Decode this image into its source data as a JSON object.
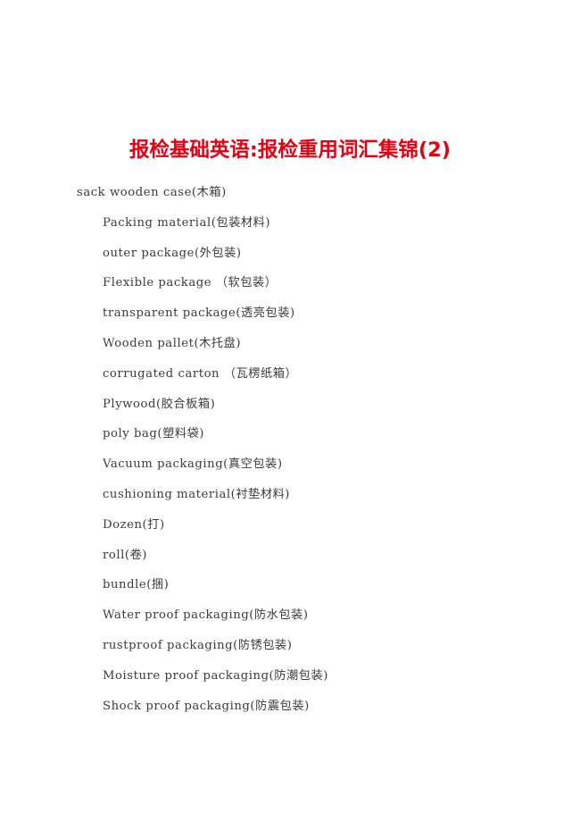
{
  "document": {
    "title": "报检基础英语:报检重用词汇集锦(2)",
    "title_color": "#e60012",
    "body_color": "#3b3b3b",
    "background_color": "#ffffff",
    "lines": [
      {
        "text": "sack wooden case(木箱)",
        "indent": 0
      },
      {
        "text": "Packing material(包装材料)",
        "indent": 1
      },
      {
        "text": "outer package(外包装)",
        "indent": 1
      },
      {
        "text": "Flexible package （软包装）",
        "indent": 1
      },
      {
        "text": "transparent package(透亮包装)",
        "indent": 1
      },
      {
        "text": "Wooden pallet(木托盘)",
        "indent": 1
      },
      {
        "text": "corrugated carton （瓦楞纸箱）",
        "indent": 1
      },
      {
        "text": "Plywood(胶合板箱)",
        "indent": 1
      },
      {
        "text": "poly bag(塑料袋)",
        "indent": 1
      },
      {
        "text": "Vacuum packaging(真空包装)",
        "indent": 1
      },
      {
        "text": "cushioning material(衬垫材料)",
        "indent": 1
      },
      {
        "text": "Dozen(打)",
        "indent": 1
      },
      {
        "text": "roll(卷)",
        "indent": 1
      },
      {
        "text": "bundle(捆)",
        "indent": 1
      },
      {
        "text": "Water proof packaging(防水包装)",
        "indent": 1
      },
      {
        "text": "rustproof packaging(防锈包装)",
        "indent": 1
      },
      {
        "text": "Moisture proof packaging(防潮包装)",
        "indent": 1
      },
      {
        "text": "Shock proof packaging(防震包装)",
        "indent": 1
      }
    ]
  }
}
